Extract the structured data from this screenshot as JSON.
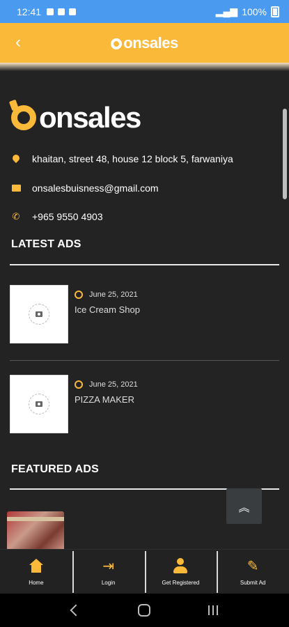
{
  "status_bar": {
    "time": "12:41",
    "battery": "100%"
  },
  "header": {
    "brand": "onsales"
  },
  "brand": {
    "name": "onsales",
    "accent_color": "#fbb93a"
  },
  "contact": {
    "address": "khaitan, street 48, house 12 block 5, farwaniya",
    "email": "onsalesbuisness@gmail.com",
    "phone": "+965 9550 4903"
  },
  "latest_ads": {
    "title": "LATEST ADS",
    "items": [
      {
        "date": "June 25, 2021",
        "title": "Ice Cream Shop"
      },
      {
        "date": "June 25, 2021",
        "title": "PIZZA MAKER"
      }
    ]
  },
  "featured_ads": {
    "title": "FEATURED ADS"
  },
  "bottom_nav": {
    "items": [
      {
        "label": "Home",
        "icon": "home-icon"
      },
      {
        "label": "Login",
        "icon": "login-icon"
      },
      {
        "label": "Get Registered",
        "icon": "user-icon"
      },
      {
        "label": "Submit Ad",
        "icon": "edit-icon"
      }
    ]
  }
}
